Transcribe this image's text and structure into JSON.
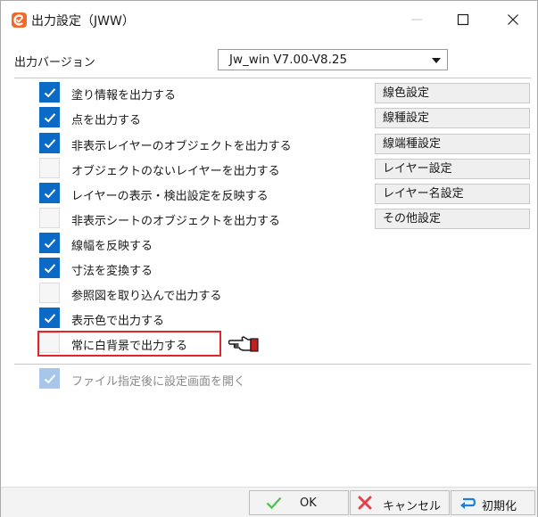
{
  "window": {
    "title": "出力設定（JWW）",
    "icons": {
      "app": "app-logo-icon",
      "minimize": "minimize-icon",
      "maximize": "maximize-icon",
      "close": "close-icon"
    }
  },
  "version": {
    "label": "出力バージョン",
    "selected": "Jw_win V7.00-V8.25"
  },
  "options": [
    {
      "label": "塗り情報を出力する",
      "checked": true
    },
    {
      "label": "点を出力する",
      "checked": true
    },
    {
      "label": "非表示レイヤーのオブジェクトを出力する",
      "checked": true
    },
    {
      "label": "オブジェクトのないレイヤーを出力する",
      "checked": false
    },
    {
      "label": "レイヤーの表示・検出設定を反映する",
      "checked": true
    },
    {
      "label": "非表示シートのオブジェクトを出力する",
      "checked": false
    },
    {
      "label": "線幅を反映する",
      "checked": true
    },
    {
      "label": "寸法を変換する",
      "checked": true
    },
    {
      "label": "参照図を取り込んで出力する",
      "checked": false
    },
    {
      "label": "表示色で出力する",
      "checked": true
    },
    {
      "label": "常に白背景で出力する",
      "checked": false
    }
  ],
  "settings_buttons": [
    "線色設定",
    "線種設定",
    "線端種設定",
    "レイヤー設定",
    "レイヤー名設定",
    "その他設定"
  ],
  "after_open": {
    "label": "ファイル指定後に設定画面を開く",
    "checked": true,
    "disabled": true
  },
  "footer": {
    "ok": "OK",
    "cancel": "キャンセル",
    "init": "初期化"
  },
  "colors": {
    "accent": "#0b6ac6",
    "highlight": "#e0262a",
    "app_icon": "#f06a2a"
  }
}
